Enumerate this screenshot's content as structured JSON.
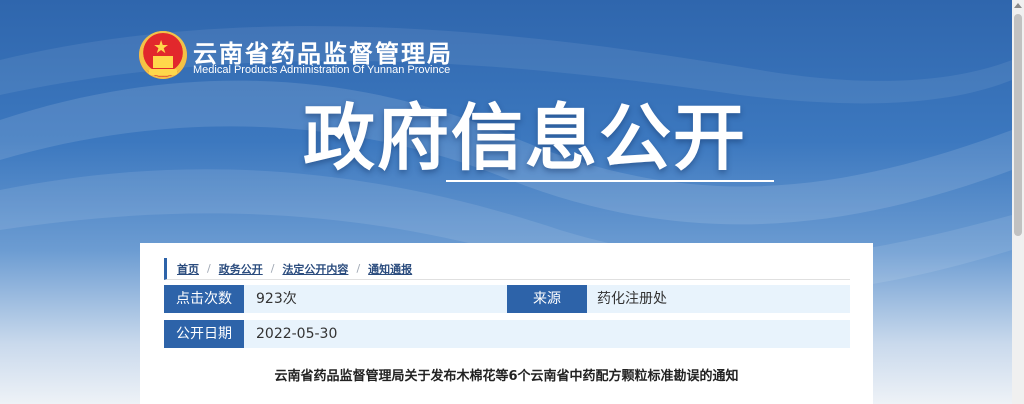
{
  "header": {
    "site_name_cn": "云南省药品监督管理局",
    "site_name_en": "Medical Products Administration Of Yunnan Province",
    "hero_title": "政府信息公开"
  },
  "breadcrumb": [
    {
      "label": "首页"
    },
    {
      "label": "政务公开"
    },
    {
      "label": "法定公开内容"
    },
    {
      "label": "通知通报"
    }
  ],
  "meta": {
    "clicks_label": "点击次数",
    "clicks_value": "923次",
    "source_label": "来源",
    "source_value": "药化注册处",
    "date_label": "公开日期",
    "date_value": "2022-05-30"
  },
  "article": {
    "title": "云南省药品监督管理局关于发布木棉花等6个云南省中药配方颗粒标准勘误的通知"
  },
  "colors": {
    "brand_blue": "#2d63a9",
    "row_bg": "#e8f3fc",
    "emblem_red": "#e2282c",
    "emblem_gold": "#ffd84b"
  },
  "icons": [
    "national-emblem-icon"
  ]
}
